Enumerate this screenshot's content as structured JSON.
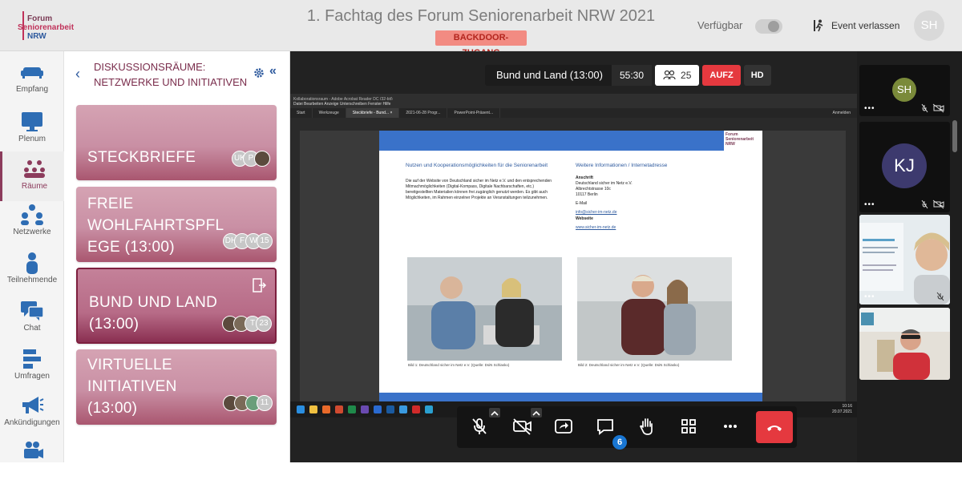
{
  "header": {
    "logo": [
      "Forum",
      "Seniorenarbeit",
      "NRW"
    ],
    "title": "1. Fachtag des Forum Seniorenarbeit NRW 2021",
    "backdoor_label": "BACKDOOR-ZUGANG",
    "availability_label": "Verfügbar",
    "leave_label": "Event verlassen",
    "user_initials": "SH"
  },
  "nav": {
    "items": [
      {
        "label": "Empfang",
        "icon": "sofa-icon"
      },
      {
        "label": "Plenum",
        "icon": "monitor-icon"
      },
      {
        "label": "Räume",
        "icon": "group-icon",
        "active": true
      },
      {
        "label": "Netzwerke",
        "icon": "network-icon"
      },
      {
        "label": "Teilnehmende",
        "icon": "person-icon"
      },
      {
        "label": "Chat",
        "icon": "chat-icon"
      },
      {
        "label": "Umfragen",
        "icon": "poll-icon"
      },
      {
        "label": "Ankündigungen",
        "icon": "megaphone-icon"
      },
      {
        "label": "",
        "icon": "camera-icon"
      }
    ]
  },
  "rooms_panel": {
    "title": "DISKUSSIONSRÄUME: NETZWERKE UND INITIATIVEN",
    "rooms": [
      {
        "name_lines": [
          "STECKBRIEFE"
        ],
        "participants": [
          "UK",
          "P",
          ""
        ],
        "active": false
      },
      {
        "name_lines": [
          "FREIE",
          "WOHLFAHRTSPFL",
          "EGE (13:00)"
        ],
        "participants": [
          "DH",
          "F",
          "W",
          "15"
        ],
        "active": false
      },
      {
        "name_lines": [
          "BUND UND LAND",
          "(13:00)"
        ],
        "participants": [
          "",
          "",
          "T",
          "23"
        ],
        "active": true
      },
      {
        "name_lines": [
          "VIRTUELLE",
          "INITIATIVEN",
          "(13:00)"
        ],
        "participants": [
          "",
          "",
          "",
          "11"
        ],
        "active": false
      }
    ]
  },
  "stage": {
    "room_label": "Bund und Land (13:00)",
    "timer": "55:30",
    "participant_count": "25",
    "record_label": "AUFZ",
    "quality_label": "HD",
    "chat_badge": "6"
  },
  "shared_screen": {
    "app_title": "Kollaborationsraum - Adobe Acrobat Reader DC (32-bit)",
    "menu": "Datei   Bearbeiten   Anzeige   Unterschreiben   Fenster   Hilfe",
    "tabs": [
      "Start",
      "Werkzeuge",
      "Steckbriefe - Bund... ×",
      "2021-06-28 Progr...",
      "PowerPoint-Präsent..."
    ],
    "signin": "Anmelden",
    "doc": {
      "logo": [
        "Forum",
        "Seniorenarbeit",
        "NRW"
      ],
      "left_heading": "Nutzen und Kooperationsmöglichkeiten für die Seniorenarbeit",
      "left_body": "Die auf der Website von Deutschland sicher im Netz e.V. und den entsprechenden Mitmachmöglichkeiten (Digital-Kompass, Digitale Nachbarschaften, etc.) bereitgestellten Materialien können frei zugänglich genutzt werden. Es gibt auch Möglichkeiten, im Rahmen einzelner Projekte an Veranstaltungen teilzunehmen.",
      "right_heading": "Weitere Informationen / Internetadresse",
      "address_label": "Anschrift",
      "address_lines": [
        "Deutschland sicher im Netz e.V.",
        "Albrechtstrasse 10c",
        "10117 Berlin"
      ],
      "email_label": "E-Mail",
      "email": "info@sicher-im-netz.de",
      "website_label": "Webseite",
      "website": "www.sicher-im-netz.de",
      "caption1": "Bild 1: Deutschland sicher im Netz e.V. (Quelle: DsiN Schlasko)",
      "caption2": "Bild 2: Deutschland sicher im Netz e.V. (Quelle: DsiN Schlasko)"
    },
    "clock": [
      "10:16",
      "20.07.2021"
    ]
  },
  "tiles": [
    {
      "initials": "SH",
      "color": "#7a8a3a"
    },
    {
      "initials": "KJ",
      "color": "#3d3a6e"
    }
  ],
  "colors": {
    "brand": "#8c3b5c",
    "room_card": "#c98fa4",
    "record": "#e5393f",
    "badge": "#1976d2"
  }
}
